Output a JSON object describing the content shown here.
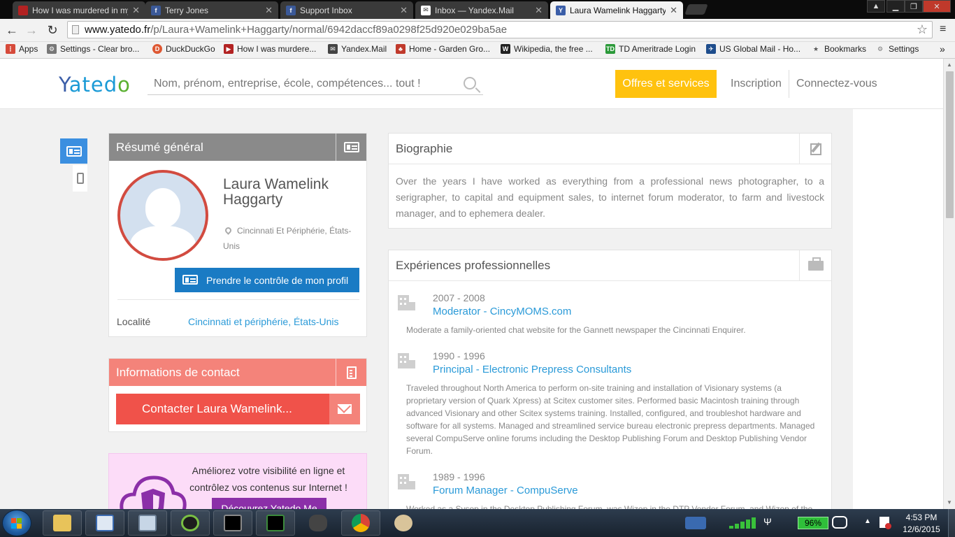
{
  "browser": {
    "tabs": [
      {
        "title": "How I was murdered in my",
        "fav": "video-icon",
        "active": false
      },
      {
        "title": "Terry Jones",
        "fav": "facebook-icon",
        "active": false
      },
      {
        "title": "Support Inbox",
        "fav": "facebook-icon",
        "active": false
      },
      {
        "title": "Inbox — Yandex.Mail",
        "fav": "mail-icon",
        "active": false
      },
      {
        "title": "Laura Wamelink Haggarty",
        "fav": "yatedo-icon",
        "active": true
      }
    ],
    "url_domain": "www.yatedo.fr",
    "url_path": "/p/Laura+Wamelink+Haggarty/normal/6942daccf89a0298f25d920e029ba5ae",
    "bookmarks": [
      {
        "label": "Apps",
        "icon": "apps-grid-icon",
        "color": "#d64a3a"
      },
      {
        "label": "Settings - Clear bro...",
        "icon": "gear-icon",
        "color": "#777777"
      },
      {
        "label": "DuckDuckGo",
        "icon": "duckduckgo-icon",
        "color": "#de5833"
      },
      {
        "label": "How I was murdere...",
        "icon": "video-icon",
        "color": "#b22222"
      },
      {
        "label": "Yandex.Mail",
        "icon": "mail-icon",
        "color": "#444444"
      },
      {
        "label": "Home - Garden Gro...",
        "icon": "garden-icon",
        "color": "#c0392b"
      },
      {
        "label": "Wikipedia, the free ...",
        "icon": "wikipedia-icon",
        "color": "#222222"
      },
      {
        "label": "TD Ameritrade Login",
        "icon": "td-icon",
        "color": "#2c9a3a"
      },
      {
        "label": "US Global Mail - Ho...",
        "icon": "usmail-icon",
        "color": "#1e4d8c"
      },
      {
        "label": "Bookmarks",
        "icon": "star-icon",
        "color": "#555555"
      },
      {
        "label": "Settings",
        "icon": "gear-icon",
        "color": "#777777"
      }
    ]
  },
  "header": {
    "logo": {
      "y": "Y",
      "at": "ate",
      "d": "d",
      "o": "o"
    },
    "search_placeholder": "Nom, prénom, entreprise, école, compétences... tout !",
    "offres": "Offres et services",
    "inscription": "Inscription",
    "connect": "Connectez-vous"
  },
  "resume": {
    "title": "Résumé général",
    "name": "Laura Wamelink Haggarty",
    "location": "Cincinnati Et Périphérie, États-Unis",
    "takeover": "Prendre le contrôle de mon profil",
    "locality_label": "Localité",
    "locality_value": "Cincinnati et périphérie, États-Unis"
  },
  "contact": {
    "title": "Informations de contact",
    "button": "Contacter Laura Wamelink..."
  },
  "promo": {
    "text": "Améliorez votre visibilité en ligne et contrôlez vos contenus sur Internet !",
    "button": "Découvrez Yatedo Me"
  },
  "bio": {
    "title": "Biographie",
    "text": "Over the years I have worked as everything from a professional news photographer, to a serigrapher, to capital and equipment sales, to internet forum moderator, to farm and livestock manager, and to ephemera dealer."
  },
  "experience": {
    "title": "Expériences professionnelles",
    "jobs": [
      {
        "years": "2007 - 2008",
        "title": "Moderator - CincyMOMS.com",
        "desc": "Moderate a family-oriented chat website for the Gannett newspaper the Cincinnati Enquirer."
      },
      {
        "years": "1990 - 1996",
        "title": "Principal - Electronic Prepress Consultants",
        "desc": "Traveled throughout North America to perform on-site training and installation of Visionary systems (a proprietary version of Quark Xpress) at Scitex customer sites. Performed basic Macintosh training through advanced Visionary and other Scitex systems training. Installed, configured, and troubleshot hardware and software for all systems. Managed and streamlined service bureau electronic prepress departments. Managed several CompuServe online forums including the Desktop Publishing Forum and Desktop Publishing Vendor Forum."
      },
      {
        "years": "1989 - 1996",
        "title": "Forum Manager - CompuServe",
        "desc": "Worked as a Sysop in the Desktop Publishing Forum, was Wizop in the DTP Vendor Forum, and Wizop of the"
      }
    ]
  },
  "taskbar": {
    "battery": "96%",
    "time": "4:53 PM",
    "date": "12/6/2015"
  },
  "colors": {
    "accent_blue": "#2a9ad8",
    "offres_yellow": "#ffc20e",
    "contact_red": "#f0524a",
    "promo_purple": "#8b2fa8"
  }
}
